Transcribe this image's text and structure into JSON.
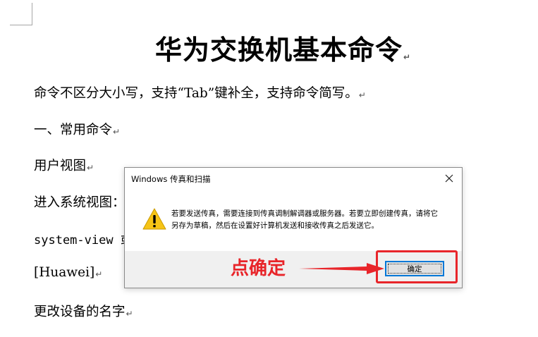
{
  "document": {
    "title": "华为交换机基本命令",
    "lines": [
      "命令不区分大小写，支持“Tab”键补全，支持命令简写。",
      "一、常用命令",
      "用户视图",
      "进入系统视图：",
      "system-view 或",
      "[Huawei]",
      "更改设备的名字"
    ],
    "paragraph_mark": "↵"
  },
  "dialog": {
    "title": "Windows 传真和扫描",
    "close_icon": "close-icon",
    "warning_icon": "warning-icon",
    "message": "若要发送传真，需要连接到传真调制解调器或服务器。若要立即创建传真，请将它另存为草稿，然后在设置好计算机发送和接收传真之后发送它。",
    "ok_label": "确定"
  },
  "annotation": {
    "text": "点确定",
    "color": "#e8252a"
  },
  "colors": {
    "accent": "#0078d7",
    "annotation": "#e8252a",
    "warning_fill": "#f6c416"
  }
}
